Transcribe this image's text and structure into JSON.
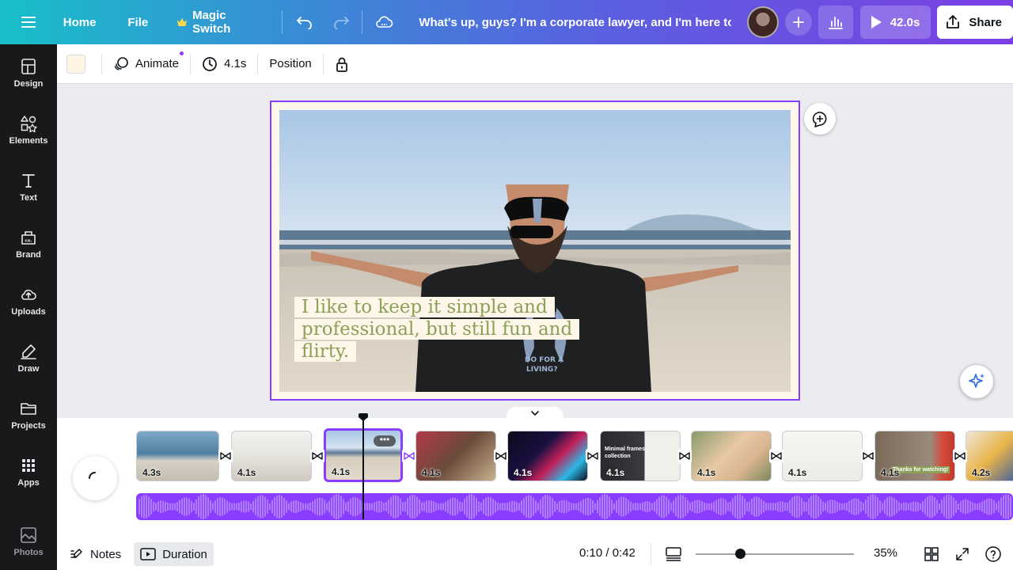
{
  "header": {
    "home_label": "Home",
    "file_label": "File",
    "magic_switch_label": "Magic Switch",
    "doc_title": "What's up, guys? I'm a corporate lawyer, and I'm here to ...",
    "play_duration": "42.0s",
    "share_label": "Share"
  },
  "sidebar": {
    "items": [
      {
        "label": "Design",
        "icon": "layout-icon"
      },
      {
        "label": "Elements",
        "icon": "shapes-icon"
      },
      {
        "label": "Text",
        "icon": "text-icon"
      },
      {
        "label": "Brand",
        "icon": "brand-icon"
      },
      {
        "label": "Uploads",
        "icon": "cloud-upload-icon"
      },
      {
        "label": "Draw",
        "icon": "pen-icon"
      },
      {
        "label": "Projects",
        "icon": "folder-icon"
      },
      {
        "label": "Apps",
        "icon": "apps-grid-icon"
      },
      {
        "label": "Photos",
        "icon": "image-icon"
      }
    ]
  },
  "toolbar": {
    "swatch_color": "#fdf5e6",
    "animate_label": "Animate",
    "duration_label": "4.1s",
    "position_label": "Position"
  },
  "canvas": {
    "caption_lines": [
      "I like to keep it simple and",
      "professional, but still fun and",
      "flirty."
    ]
  },
  "timeline": {
    "clips": [
      {
        "duration": "4.3s"
      },
      {
        "duration": "4.1s"
      },
      {
        "duration": "4.1s",
        "selected": true
      },
      {
        "duration": "4.1s"
      },
      {
        "duration": "4.1s"
      },
      {
        "duration": "4.1s",
        "title": "Minimal frames collection"
      },
      {
        "duration": "4.1s"
      },
      {
        "duration": "4.1s"
      },
      {
        "duration": "4.1s",
        "text": "Thanks for watching!"
      },
      {
        "duration": "4.2s"
      }
    ]
  },
  "bottombar": {
    "notes_label": "Notes",
    "duration_label": "Duration",
    "time_display": "0:10 / 0:42",
    "zoom": "35%",
    "zoom_fraction": 0.28
  },
  "colors": {
    "accent": "#8b3dff",
    "caption_text": "#8ca05a",
    "caption_bg": "#fdf6e9"
  }
}
